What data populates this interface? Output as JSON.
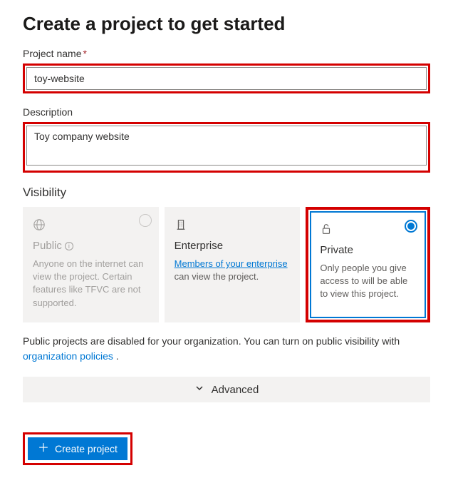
{
  "heading": "Create a project to get started",
  "projectName": {
    "label": "Project name",
    "required": "*",
    "value": "toy-website"
  },
  "description": {
    "label": "Description",
    "value": "Toy company website"
  },
  "visibility": {
    "label": "Visibility",
    "options": [
      {
        "title": "Public",
        "desc": "Anyone on the internet can view the project. Certain features like TFVC are not supported.",
        "disabled": true,
        "selected": false
      },
      {
        "title": "Enterprise",
        "linkText": "Members of your enterprise",
        "descSuffix": " can view the project.",
        "disabled": false,
        "selected": false
      },
      {
        "title": "Private",
        "desc": "Only people you give access to will be able to view this project.",
        "disabled": false,
        "selected": true
      }
    ]
  },
  "notice": {
    "textBefore": "Public projects are disabled for your organization. You can turn on public visibility with ",
    "linkText": "organization policies",
    "textAfter": " ."
  },
  "advanced": {
    "label": "Advanced"
  },
  "submit": {
    "label": "Create project"
  }
}
